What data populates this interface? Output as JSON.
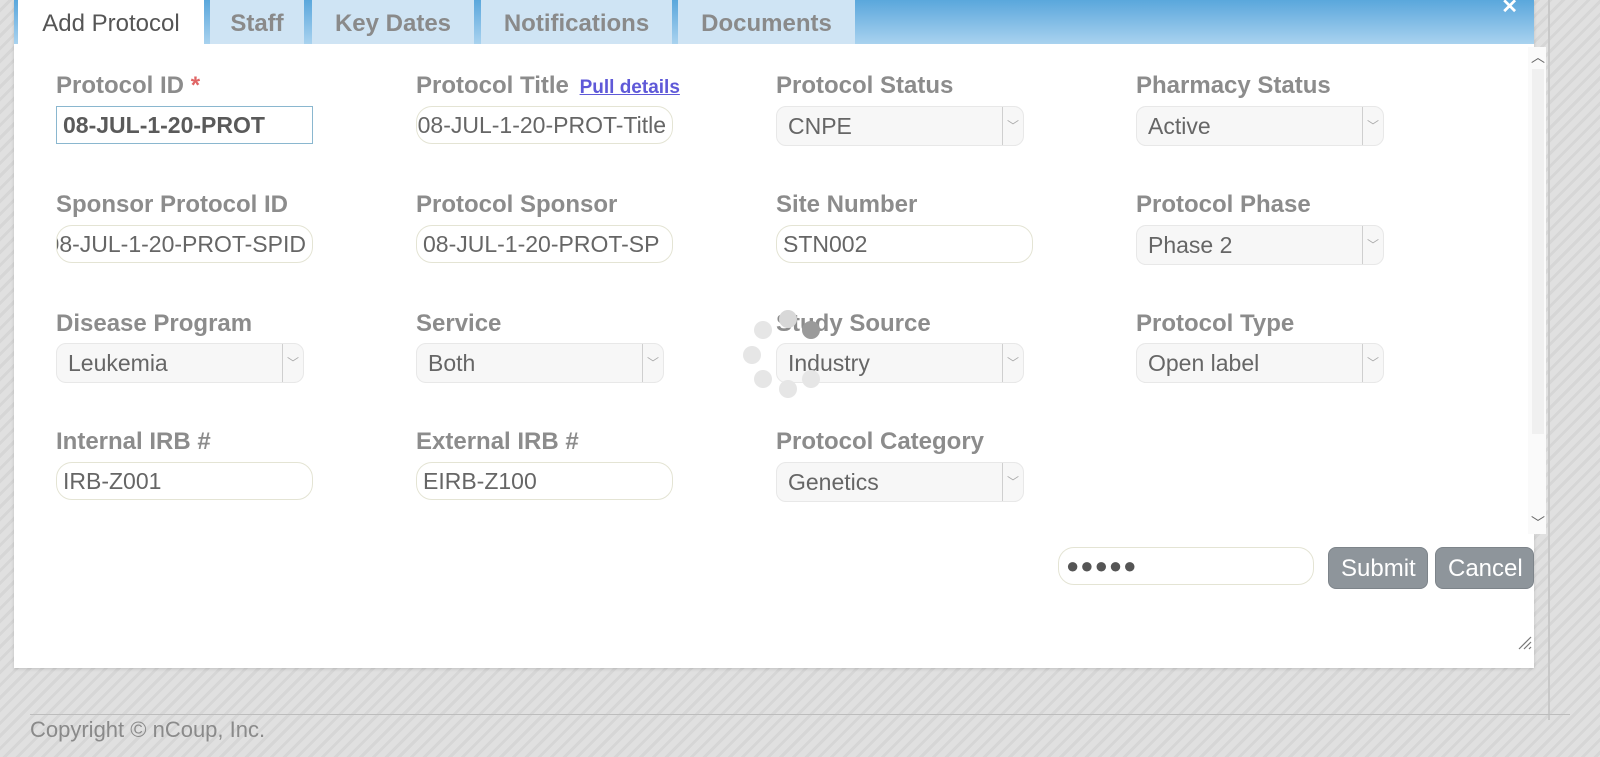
{
  "tabs": [
    {
      "label": "Add Protocol",
      "active": true
    },
    {
      "label": "Staff"
    },
    {
      "label": "Key Dates"
    },
    {
      "label": "Notifications"
    },
    {
      "label": "Documents"
    }
  ],
  "close_icon": "close-icon",
  "fields": {
    "protocol_id": {
      "label": "Protocol ID",
      "required_mark": "*",
      "value": "08-JUL-1-20-PROT"
    },
    "protocol_title": {
      "label": "Protocol Title",
      "link": "Pull details",
      "value": "08-JUL-1-20-PROT-Title"
    },
    "protocol_status": {
      "label": "Protocol Status",
      "value": "CNPE"
    },
    "pharmacy_status": {
      "label": "Pharmacy Status",
      "value": "Active"
    },
    "sponsor_protocol_id": {
      "label": "Sponsor Protocol ID",
      "value": "08-JUL-1-20-PROT-SPID"
    },
    "protocol_sponsor": {
      "label": "Protocol Sponsor",
      "value": "08-JUL-1-20-PROT-SP"
    },
    "site_number": {
      "label": "Site Number",
      "value": "STN002"
    },
    "protocol_phase": {
      "label": "Protocol Phase",
      "value": "Phase 2"
    },
    "disease_program": {
      "label": "Disease Program",
      "value": "Leukemia"
    },
    "service": {
      "label": "Service",
      "value": "Both"
    },
    "study_source": {
      "label": "Study Source",
      "value": "Industry"
    },
    "protocol_type": {
      "label": "Protocol Type",
      "value": "Open label"
    },
    "internal_irb": {
      "label": "Internal IRB #",
      "value": "IRB-Z001"
    },
    "external_irb": {
      "label": "External IRB #",
      "value": "EIRB-Z100"
    },
    "protocol_category": {
      "label": "Protocol Category",
      "value": "Genetics"
    }
  },
  "footer_actions": {
    "password_value": "●●●●●",
    "submit_label": "Submit",
    "cancel_label": "Cancel"
  },
  "copyright": "Copyright © nCoup, Inc."
}
